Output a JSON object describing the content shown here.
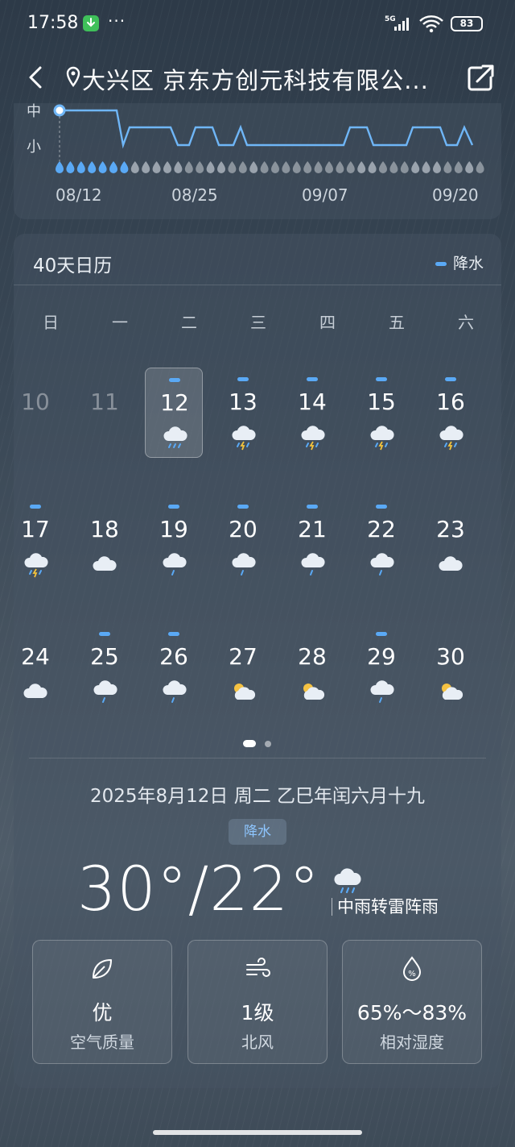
{
  "status_bar": {
    "time": "17:58",
    "network": "5G",
    "battery": "83"
  },
  "header": {
    "location": "大兴区 京东方创元科技有限公..."
  },
  "precip_chart": {
    "level_labels": [
      "中",
      "小"
    ],
    "dates": [
      "08/12",
      "08/25",
      "09/07",
      "09/20"
    ]
  },
  "calendar": {
    "title": "40天日历",
    "legend": "降水",
    "weekdays": [
      "日",
      "一",
      "二",
      "三",
      "四",
      "五",
      "六"
    ],
    "weeks": [
      [
        {
          "day": "10",
          "icon": "none",
          "rain": false,
          "past": true
        },
        {
          "day": "11",
          "icon": "none",
          "rain": false,
          "past": true
        },
        {
          "day": "12",
          "icon": "rain-cloud-icon",
          "rain": true,
          "selected": true
        },
        {
          "day": "13",
          "icon": "thunder-shower-icon",
          "rain": true
        },
        {
          "day": "14",
          "icon": "thunder-shower-icon",
          "rain": true
        },
        {
          "day": "15",
          "icon": "thunder-shower-icon",
          "rain": true
        },
        {
          "day": "16",
          "icon": "thunder-shower-icon",
          "rain": true
        }
      ],
      [
        {
          "day": "17",
          "icon": "thunder-shower-icon",
          "rain": true
        },
        {
          "day": "18",
          "icon": "cloud-icon",
          "rain": false
        },
        {
          "day": "19",
          "icon": "light-rain-icon",
          "rain": true
        },
        {
          "day": "20",
          "icon": "light-rain-icon",
          "rain": true
        },
        {
          "day": "21",
          "icon": "light-rain-icon",
          "rain": true
        },
        {
          "day": "22",
          "icon": "light-rain-icon",
          "rain": true
        },
        {
          "day": "23",
          "icon": "cloud-icon",
          "rain": false
        }
      ],
      [
        {
          "day": "24",
          "icon": "cloud-icon",
          "rain": false
        },
        {
          "day": "25",
          "icon": "light-rain-icon",
          "rain": true
        },
        {
          "day": "26",
          "icon": "light-rain-icon",
          "rain": true
        },
        {
          "day": "27",
          "icon": "partly-cloudy-icon",
          "rain": false
        },
        {
          "day": "28",
          "icon": "partly-cloudy-icon",
          "rain": false
        },
        {
          "day": "29",
          "icon": "light-rain-icon",
          "rain": true
        },
        {
          "day": "30",
          "icon": "partly-cloudy-icon",
          "rain": false
        }
      ]
    ]
  },
  "detail": {
    "date_line": "2025年8月12日 周二 乙巳年闰六月十九",
    "tag": "降水",
    "temperature": "30°/22°",
    "description": "中雨转雷阵雨",
    "metrics": [
      {
        "value": "优",
        "label": "空气质量",
        "icon": "leaf-icon"
      },
      {
        "value": "1级",
        "label": "北风",
        "icon": "wind-icon"
      },
      {
        "value": "65%～83%",
        "label": "相对湿度",
        "icon": "humidity-icon"
      }
    ]
  },
  "colors": {
    "accent": "#5aa9f5",
    "tag_text": "#8ec6ff"
  }
}
